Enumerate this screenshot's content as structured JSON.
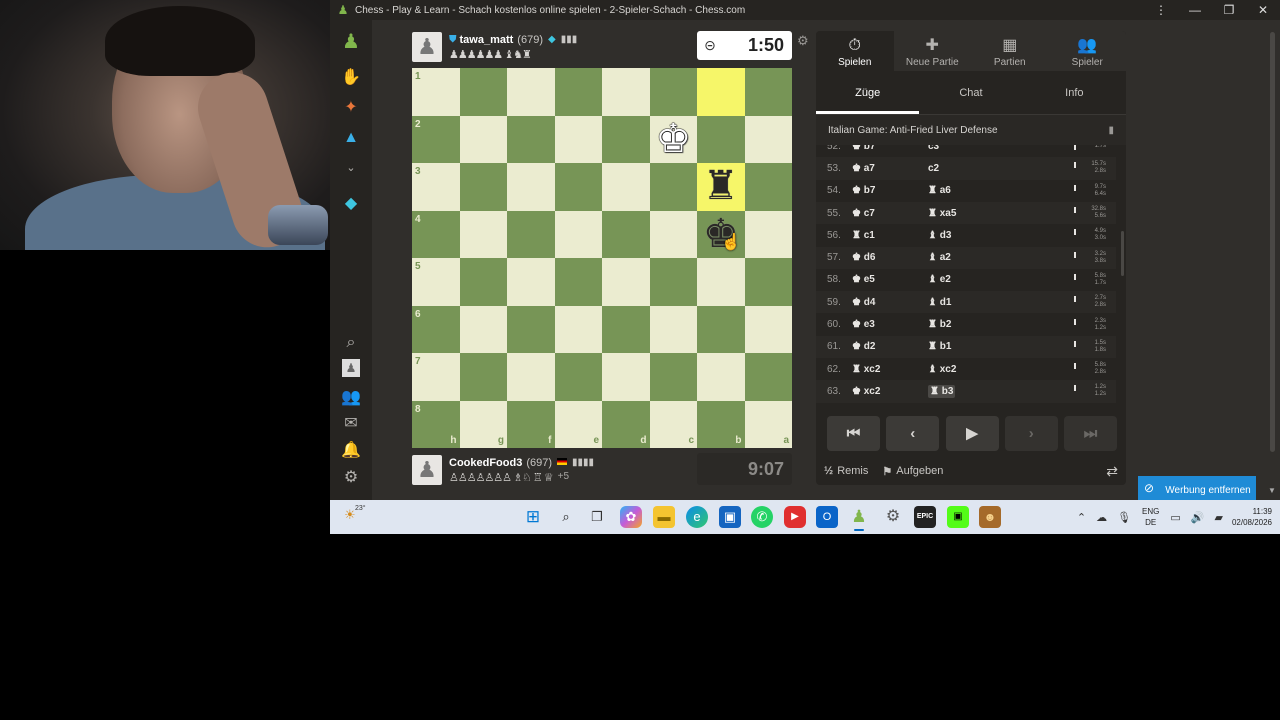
{
  "window": {
    "title": "Chess - Play & Learn - Schach kostenlos online spielen - 2-Spieler-Schach - Chess.com",
    "controls": [
      "⋮",
      "—",
      "❐",
      "✕"
    ]
  },
  "players": {
    "top": {
      "name": "tawa_matt",
      "rating": "(679)",
      "extra": "▮▮▮",
      "captured": "♟♟♟♟♟♟ ♝♞♜",
      "clock": "1:50"
    },
    "bottom": {
      "name": "CookedFood3",
      "rating": "(697)",
      "extra": "▮▮▮▮",
      "captured": "♙♙♙♙♙♙♙ ♗♘ ♖ ♕",
      "plus": "+5",
      "clock": "9:07"
    }
  },
  "board": {
    "ranks": [
      "1",
      "2",
      "3",
      "4",
      "5",
      "6",
      "7",
      "8"
    ],
    "files": [
      "h",
      "g",
      "f",
      "e",
      "d",
      "c",
      "b",
      "a"
    ],
    "highlight": [
      [
        0,
        6
      ],
      [
        2,
        6
      ]
    ],
    "pieces": [
      {
        "row": 1,
        "col": 5,
        "glyph": "♚",
        "color": "white"
      },
      {
        "row": 2,
        "col": 6,
        "glyph": "♜",
        "color": "black"
      },
      {
        "row": 3,
        "col": 6,
        "glyph": "♚",
        "color": "black"
      }
    ]
  },
  "panel": {
    "tabs": [
      {
        "label": "Spielen",
        "icon": "⏱"
      },
      {
        "label": "Neue Partie",
        "icon": "✚"
      },
      {
        "label": "Partien",
        "icon": "▦"
      },
      {
        "label": "Spieler",
        "icon": "👥"
      }
    ],
    "subtabs": [
      "Züge",
      "Chat",
      "Info"
    ],
    "opening": "Italian Game: Anti-Fried Liver Defense",
    "moves": [
      {
        "num": "52.",
        "w": "♚ b7",
        "b": "c3",
        "t1": "",
        "t2": "1.7s"
      },
      {
        "num": "53.",
        "w": "♚ a7",
        "b": "c2",
        "t1": "15.7s",
        "t2": "2.8s"
      },
      {
        "num": "54.",
        "w": "♚ b7",
        "b": "♜ a6",
        "t1": "9.7s",
        "t2": "6.4s"
      },
      {
        "num": "55.",
        "w": "♚ c7",
        "b": "♜ xa5",
        "t1": "32.8s",
        "t2": "5.6s"
      },
      {
        "num": "56.",
        "w": "♜ c1",
        "b": "♝ d3",
        "t1": "4.9s",
        "t2": "3.0s"
      },
      {
        "num": "57.",
        "w": "♚ d6",
        "b": "♝ a2",
        "t1": "3.2s",
        "t2": "3.8s"
      },
      {
        "num": "58.",
        "w": "♚ e5",
        "b": "♝ e2",
        "t1": "5.8s",
        "t2": "1.7s"
      },
      {
        "num": "59.",
        "w": "♚ d4",
        "b": "♝ d1",
        "t1": "2.7s",
        "t2": "2.8s"
      },
      {
        "num": "60.",
        "w": "♚ e3",
        "b": "♜ b2",
        "t1": "2.3s",
        "t2": "1.2s"
      },
      {
        "num": "61.",
        "w": "♚ d2",
        "b": "♜ b1",
        "t1": "1.5s",
        "t2": "1.8s"
      },
      {
        "num": "62.",
        "w": "♜ xc2",
        "b": "♝ xc2",
        "t1": "5.8s",
        "t2": "2.8s"
      },
      {
        "num": "63.",
        "w": "♚ xc2",
        "b": "♜ b3",
        "t1": "1.2s",
        "t2": "1.2s"
      }
    ],
    "controls": [
      "⏮",
      "‹",
      "▶",
      "›",
      "⏭"
    ],
    "draw_label": "Remis",
    "draw_glyph": "½",
    "resign_label": "Aufgeben",
    "resign_glyph": "⚑",
    "flip_glyph": "⇄"
  },
  "ad": {
    "label": "Werbung entfernen",
    "icon": "⊘"
  },
  "taskbar": {
    "weather_temp": "23°",
    "lang_top": "ENG",
    "lang_bottom": "DE",
    "time": "11:39",
    "date": "02/08/2026"
  }
}
